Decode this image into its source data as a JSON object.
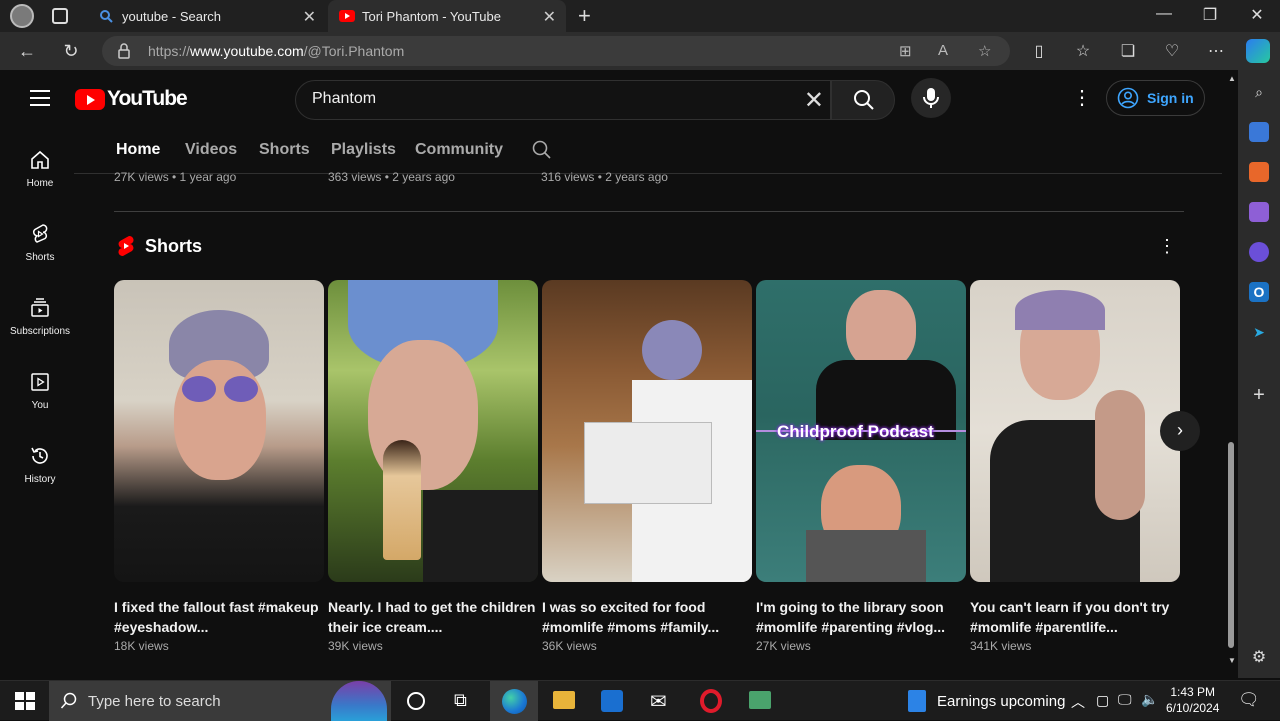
{
  "browser": {
    "tabs": [
      {
        "label": "youtube - Search",
        "active": false
      },
      {
        "label": "Tori Phantom - YouTube",
        "active": true
      }
    ],
    "url": {
      "prefix": "https://",
      "host": "www.youtube.com",
      "path": "/@Tori.Phantom"
    }
  },
  "yt": {
    "logo_text": "YouTube",
    "search_query": "Phantom",
    "signin_label": "Sign in",
    "guide": [
      {
        "label": "Home",
        "icon": "home-icon"
      },
      {
        "label": "Shorts",
        "icon": "shorts-icon"
      },
      {
        "label": "Subscriptions",
        "icon": "subscriptions-icon"
      },
      {
        "label": "You",
        "icon": "you-icon"
      },
      {
        "label": "History",
        "icon": "history-icon"
      }
    ],
    "channel_tabs": [
      "Home",
      "Videos",
      "Shorts",
      "Playlists",
      "Community"
    ],
    "prev_row_meta": [
      "27K views • 1 year ago",
      "363 views • 2 years ago",
      "316 views • 2 years ago"
    ],
    "shorts_section_title": "Shorts",
    "shorts": [
      {
        "title": "I fixed the fallout fast #makeup #eyeshadow...",
        "views": "18K views"
      },
      {
        "title": "Nearly. I had to get the children their ice cream....",
        "views": "39K views"
      },
      {
        "title": "I was so excited for food #momlife #moms #family...",
        "views": "36K views"
      },
      {
        "title": "I'm going to the library soon #momlife #parenting #vlog...",
        "views": "27K views"
      },
      {
        "title": "You can't learn if you don't try #momlife #parentlife...",
        "views": "341K views"
      }
    ],
    "podcast_caption": "Childproof Podcast"
  },
  "taskbar": {
    "search_placeholder": "Type here to search",
    "news": "Earnings upcoming",
    "time": "1:43 PM",
    "date": "6/10/2024"
  },
  "colors": {
    "accent_blue": "#3ea6ff",
    "youtube_red": "#ff0000",
    "background": "#0f0f0f"
  }
}
